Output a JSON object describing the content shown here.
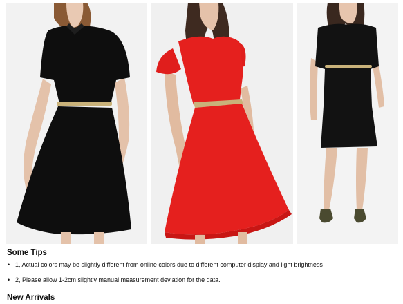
{
  "images": [
    {
      "icon": "black-collared-dress-photo",
      "dress_color": "#0e0e0e"
    },
    {
      "icon": "red-chiffon-dress-photo",
      "dress_color": "#e5201e"
    },
    {
      "icon": "black-sheath-dress-photo",
      "dress_color": "#121212"
    }
  ],
  "tips": {
    "title": "Some Tips",
    "items": [
      "1, Actual colors may be slightly different from online colors due to different computer display and light brightness",
      "2, Please allow 1-2cm slightly manual measurement deviation for the data."
    ]
  },
  "new_arrivals": {
    "title": "New Arrivals"
  }
}
